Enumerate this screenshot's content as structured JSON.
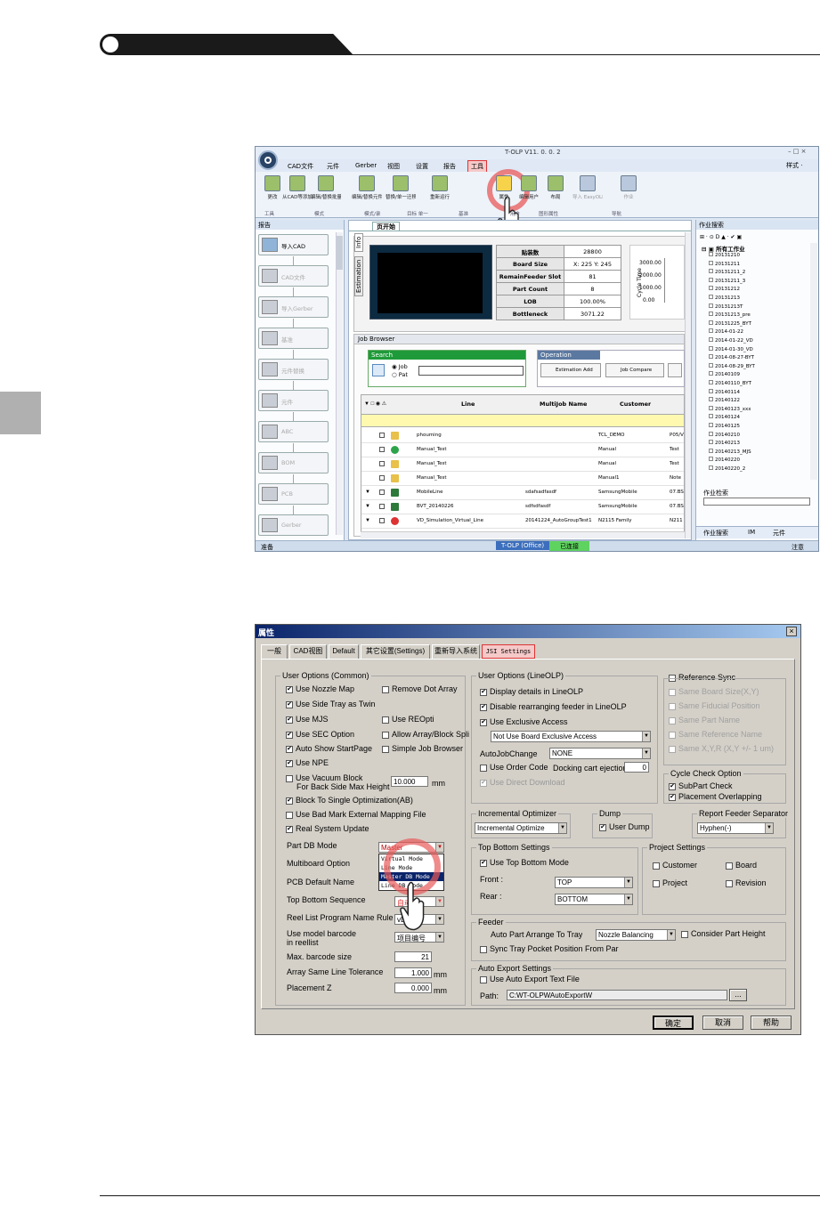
{
  "page": {
    "header_bar_color": "#1a1a1a"
  },
  "app1": {
    "title": "T-OLP V11. 0. 0. 2",
    "style_label": "样式 ·",
    "menus": [
      "CAD文件",
      "元件",
      "Gerber",
      "视图",
      "设置",
      "报告",
      "工具"
    ],
    "ribbon_buttons": [
      "更改",
      "从CAD等添加",
      "编辑/替换批量修改",
      "编辑/替换元件",
      "替换/单一迁移",
      "重新运行",
      "属性",
      "编辑用户",
      "布局",
      "导入 EasyOLP",
      "作业"
    ],
    "ribbon_groups": [
      "工具",
      "模式",
      "模式/录",
      "目标 单一",
      "基准",
      "用户",
      "图形属性",
      "导航"
    ],
    "left_panel_title": "报告",
    "left_items": [
      "导入CAD",
      "CAD文件",
      "导入Gerber",
      "基准",
      "元件替换",
      "元件",
      "ABC",
      "BOM",
      "PCB",
      "Gerber"
    ],
    "doc_tab": "页开始",
    "info_tabs": [
      "Info",
      "Estimation"
    ],
    "est_table": [
      [
        "贴装数",
        "28800"
      ],
      [
        "Board Size",
        "X: 225  Y: 245"
      ],
      [
        "RemainFeeder Slot",
        "81"
      ],
      [
        "Part Count",
        "8"
      ],
      [
        "LOB",
        "100.00%"
      ],
      [
        "Bottleneck",
        "3071.22"
      ]
    ],
    "mini_chart": {
      "axis_label": "Cycle Time",
      "ticks": [
        "3000.00",
        "2000.00",
        "1000.00",
        "0.00"
      ]
    },
    "job_browser": "Job Browser",
    "search_label": "Search",
    "radio_job": "Job",
    "radio_pat": "Pat",
    "operation_label": "Operation",
    "btn_est": "Estimation Add",
    "btn_cmp": "Job Compare",
    "col_headers": [
      "Line",
      "MultiJob Name",
      "Customer"
    ],
    "rows": [
      {
        "line": "phouming",
        "multi": "",
        "cust": "TCL_DEMO",
        "extra": "P05/V"
      },
      {
        "line": "Manual_Test",
        "multi": "",
        "cust": "Manual",
        "extra": "Test"
      },
      {
        "line": "Manual_Test",
        "multi": "",
        "cust": "Manual",
        "extra": "Test"
      },
      {
        "line": "Manual_Test",
        "multi": "",
        "cust": "Manual1",
        "extra": "Note"
      },
      {
        "line": "MobileLine",
        "multi": "sdafsadfasdf",
        "cust": "SamsungMobile",
        "extra": "07.BS"
      },
      {
        "line": "BVT_20140226",
        "multi": "sdfsdfasdf",
        "cust": "SamsungMobile",
        "extra": "07.BS"
      },
      {
        "line": "VD_Simulation_Virtual_Line",
        "multi": "20141224_AutoGroupTest1",
        "cust": "N2115 Family",
        "extra": "N211"
      }
    ],
    "right_panel_title": "作业搜索",
    "tree_root": "所有工作业",
    "tree_items": [
      "20131210",
      "20131211",
      "20131211_2",
      "20131211_3",
      "20131212",
      "20131213",
      "20131213T",
      "20131213_pre",
      "20131225_BYT",
      "2014-01-22",
      "2014-01-22_VD",
      "2014-01-30_VD",
      "2014-08-27-BYT",
      "2014-08-29_BYT",
      "20140109",
      "20140110_BYT",
      "20140114",
      "20140122",
      "20140123_xxx",
      "20140124",
      "20140125",
      "20140210",
      "20140213",
      "20140213_MJS",
      "20140220",
      "20140220_2"
    ],
    "job_search_label": "作业检索",
    "right_tabs": [
      "作业搜索",
      "IM",
      "元件"
    ],
    "status_left": "准备",
    "status_mid1": "T-OLP (Office)",
    "status_mid2": "已连接",
    "status_right": "注意"
  },
  "dialog": {
    "title": "属性",
    "tabs": [
      "一般",
      "CAD视图",
      "Default",
      "其它设置(Settings)",
      "重新导入系统",
      "JSI Settings"
    ],
    "user_common": "User Options (Common)",
    "common_items": [
      {
        "label": "Use Nozzle Map",
        "checked": true
      },
      {
        "label": "Remove Dot Array",
        "checked": false
      },
      {
        "label": "Use Side Tray as Twin",
        "checked": true
      },
      {
        "label": "Use MJS",
        "checked": true
      },
      {
        "label": "Use REOpti",
        "checked": false
      },
      {
        "label": "Use SEC Option",
        "checked": true
      },
      {
        "label": "Allow Array/Block Spli",
        "checked": false
      },
      {
        "label": "Auto Show StartPage",
        "checked": true
      },
      {
        "label": "Simple Job Browser",
        "checked": false
      },
      {
        "label": "Use NPE",
        "checked": true
      }
    ],
    "vacuum_line1": "Use Vacuum Block",
    "vacuum_line2": "For Back Side Max Height",
    "vacuum_value": "10.000",
    "vacuum_unit": "mm",
    "block_single": "Block To Single Optimization(AB)",
    "bad_mark": "Use Bad Mark External Mapping File",
    "real_update": "Real System Update",
    "part_db_mode": "Part DB Mode",
    "part_db_value": "Master",
    "part_db_options": [
      "Virtual Mode",
      "Line Mode",
      "Master DB Mode",
      "Line DB Mode"
    ],
    "multiboard": "Multiboard Option",
    "pcb_default": "PCB Default Name",
    "top_bottom_seq": "Top Bottom Sequence",
    "top_bottom_seq_value": "自动",
    "reel_list": "Reel List Program Name Rule",
    "reel_list_value": "vD",
    "use_model_barcode1": "Use model barcode",
    "use_model_barcode2": "in reellist",
    "use_model_barcode_value": "项目编号",
    "max_barcode": "Max. barcode size",
    "max_barcode_value": "21",
    "array_tol": "Array Same Line Tolerance",
    "array_tol_value": "1.000",
    "placement_z": "Placement Z",
    "placement_z_value": "0.000",
    "mm": "mm",
    "user_lineolp": "User Options (LineOLP)",
    "lineolp_items": [
      "Display details in LineOLP",
      "Disable rearranging feeder in LineOLP",
      "Use Exclusive Access"
    ],
    "exclusive_value": "Not Use Board Exclusive Access",
    "autojobchange": "AutoJobChange",
    "autojobchange_value": "NONE",
    "use_order_code": "Use Order Code",
    "docking_cart": "Docking cart ejection",
    "docking_value": "0",
    "use_direct_download": "Use Direct Download",
    "ref_sync": "Reference Sync",
    "ref_items": [
      "Same Board Size(X,Y)",
      "Same Fiducial Position",
      "Same Part Name",
      "Same Reference Name",
      "Same X,Y,R (X,Y +/- 1 um)"
    ],
    "cycle_check": "Cycle Check Option",
    "cycle_items": [
      "SubPart Check",
      "Placement Overlapping"
    ],
    "incr_opt": "Incremental Optimizer",
    "incr_value": "Incremental Optimize",
    "dump": "Dump",
    "use_dump": "User Dump",
    "report_sep": "Report Feeder Separator",
    "report_sep_value": "Hyphen(-)",
    "top_bottom_settings": "Top Bottom Settings",
    "use_top_bottom": "Use Top Bottom Mode",
    "front": "Front :",
    "front_value": "TOP",
    "rear": "Rear :",
    "rear_value": "BOTTOM",
    "project_settings": "Project Settings",
    "proj_items": [
      "Customer",
      "Board",
      "Project",
      "Revision"
    ],
    "feeder": "Feeder",
    "auto_part": "Auto Part Arrange To Tray",
    "auto_part_value": "Nozzle Balancing",
    "consider_height": "Consider Part Height",
    "sync_tray": "Sync Tray Pocket Position From Par",
    "auto_export": "Auto Export Settings",
    "use_auto_export": "Use Auto Export Text File",
    "path_label": "Path:",
    "path_value": "C:WT-OLPWAutoExportW",
    "browse": "...",
    "ok": "确定",
    "cancel": "取消",
    "help": "帮助"
  }
}
